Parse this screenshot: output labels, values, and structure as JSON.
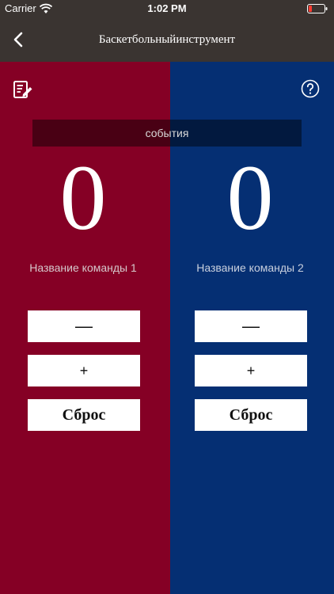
{
  "status_bar": {
    "carrier": "Carrier",
    "time": "1:02 PM"
  },
  "nav": {
    "title": "Баскетбольныйинструмент",
    "back_icon": "chevron-left-icon"
  },
  "toolbar": {
    "edit_icon": "edit-note-icon",
    "help_icon": "help-circle-icon"
  },
  "events": {
    "label": "события"
  },
  "team1": {
    "score": "0",
    "name": "Название команды 1",
    "minus_label": "—",
    "plus_label": "+",
    "reset_label": "Сброс"
  },
  "team2": {
    "score": "0",
    "name": "Название команды 2",
    "minus_label": "—",
    "plus_label": "+",
    "reset_label": "Сброс"
  },
  "colors": {
    "header": "#3a3431",
    "team1_bg": "#850025",
    "team2_bg": "#052f73",
    "button_bg": "#ffffff"
  }
}
